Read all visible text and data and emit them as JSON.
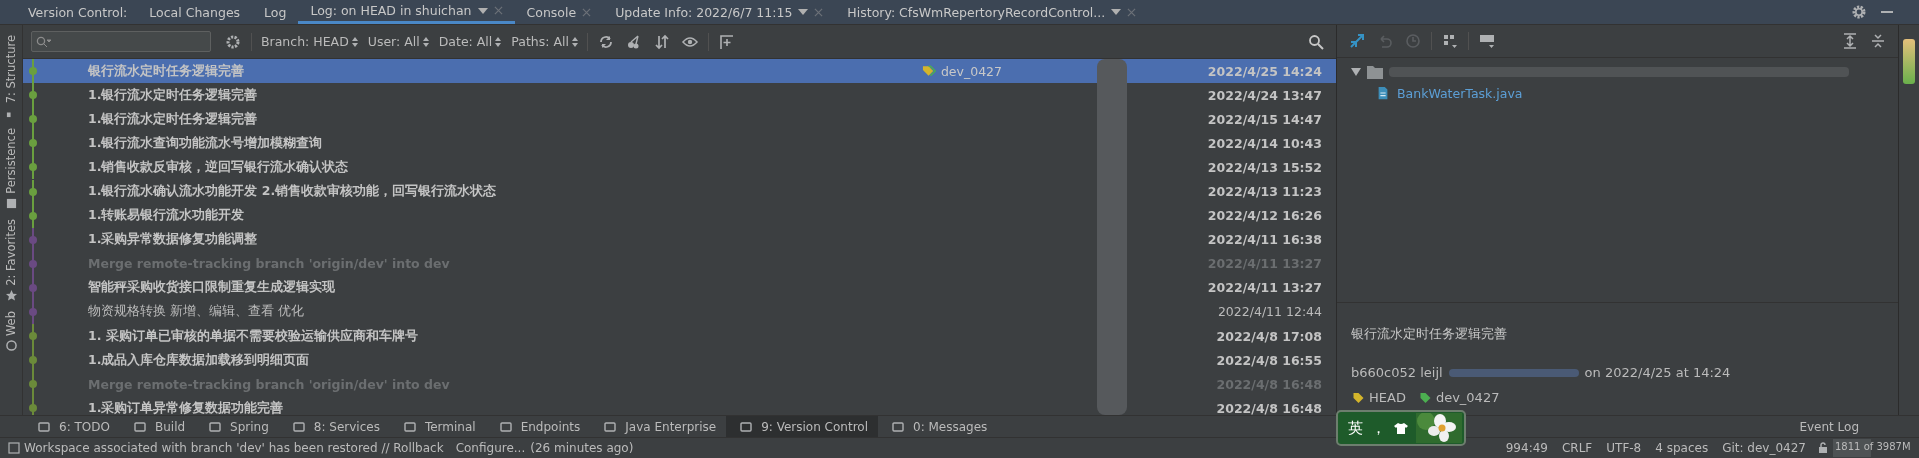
{
  "tool_window": {
    "label": "Version Control:",
    "tabs": [
      {
        "label": "Local Changes",
        "selected": false,
        "dropdown": false,
        "closable": false
      },
      {
        "label": "Log",
        "selected": false,
        "dropdown": false,
        "closable": false
      },
      {
        "label": "Log: on HEAD in shuichan",
        "selected": true,
        "dropdown": true,
        "closable": true
      },
      {
        "label": "Console",
        "selected": false,
        "dropdown": false,
        "closable": true
      },
      {
        "label": "Update Info: 2022/6/7 11:15",
        "selected": false,
        "dropdown": true,
        "closable": true
      },
      {
        "label": "History: CfsWmRepertoryRecordControl...",
        "selected": false,
        "dropdown": true,
        "closable": true
      }
    ]
  },
  "side_tools": [
    {
      "label": "7: Structure"
    },
    {
      "label": "Persistence"
    },
    {
      "label": "2: Favorites"
    },
    {
      "label": "Web"
    }
  ],
  "filters": [
    "Branch: HEAD",
    "User: All",
    "Date: All",
    "Paths: All"
  ],
  "commits": [
    {
      "message": "银行流水定时任务逻辑完善",
      "date": "2022/4/25 14:24",
      "kind": "own",
      "selected": true,
      "color": "#6a9f3f",
      "tag": "dev_0427"
    },
    {
      "message": "1.银行流水定时任务逻辑完善",
      "date": "2022/4/24 13:47",
      "kind": "own",
      "selected": false,
      "color": "#6a9f3f"
    },
    {
      "message": "1.银行流水定时任务逻辑完善",
      "date": "2022/4/15 14:47",
      "kind": "own",
      "selected": false,
      "color": "#6a9f3f"
    },
    {
      "message": "1.银行流水查询功能流水号增加模糊查询",
      "date": "2022/4/14 10:43",
      "kind": "own",
      "selected": false,
      "color": "#6a9f3f"
    },
    {
      "message": "1.销售收款反审核，逆回写银行流水确认状态",
      "date": "2022/4/13 15:52",
      "kind": "own",
      "selected": false,
      "color": "#6a9f3f"
    },
    {
      "message": "1.银行流水确认流水功能开发 2.销售收款审核功能，回写银行流水状态",
      "date": "2022/4/13 11:23",
      "kind": "own",
      "selected": false,
      "color": "#6a9f3f"
    },
    {
      "message": "1.转账易银行流水功能开发",
      "date": "2022/4/12 16:26",
      "kind": "own",
      "selected": false,
      "color": "#6a9f3f"
    },
    {
      "message": "1.采购异常数据修复功能调整",
      "date": "2022/4/11 16:38",
      "kind": "own",
      "selected": false,
      "color": "#6a4a82"
    },
    {
      "message": "Merge remote-tracking branch 'origin/dev' into dev",
      "date": "2022/4/11 13:27",
      "kind": "merge",
      "selected": false,
      "color": "#6a4a82"
    },
    {
      "message": "智能秤采购收货接口限制重复生成逻辑实现",
      "date": "2022/4/11 13:27",
      "kind": "own",
      "selected": false,
      "color": "#6a4a82"
    },
    {
      "message": "物资规格转换 新增、编辑、查看 优化",
      "date": "2022/4/11 12:44",
      "kind": "other",
      "selected": false,
      "color": "#6a4a82"
    },
    {
      "message": "1. 采购订单已审核的单据不需要校验运输供应商和车牌号",
      "date": "2022/4/8 17:08",
      "kind": "own",
      "selected": false,
      "color": "#6b8a3a"
    },
    {
      "message": "1.成品入库仓库数据加载移到明细页面",
      "date": "2022/4/8 16:55",
      "kind": "own",
      "selected": false,
      "color": "#6b8a3a"
    },
    {
      "message": "Merge remote-tracking branch 'origin/dev' into dev",
      "date": "2022/4/8 16:48",
      "kind": "merge",
      "selected": false,
      "color": "#6b8a3a"
    },
    {
      "message": "1.采购订单异常修复数据功能完善",
      "date": "2022/4/8 16:48",
      "kind": "own",
      "selected": false,
      "color": "#6b8a3a"
    }
  ],
  "changed_files": {
    "file": "BankWaterTask.java"
  },
  "details": {
    "message": "银行流水定时任务逻辑完善",
    "hash_author": "b660c052 leijl",
    "when": "on 2022/4/25 at 14:24",
    "tags": [
      {
        "label": "HEAD",
        "color": "#d4b52b"
      },
      {
        "label": "dev_0427",
        "color": "#4caf50"
      }
    ]
  },
  "bottom_tools": [
    {
      "label": "6: TODO",
      "selected": false
    },
    {
      "label": "Build",
      "selected": false
    },
    {
      "label": "Spring",
      "selected": false
    },
    {
      "label": "8: Services",
      "selected": false
    },
    {
      "label": "Terminal",
      "selected": false
    },
    {
      "label": "Endpoints",
      "selected": false
    },
    {
      "label": "Java Enterprise",
      "selected": false
    },
    {
      "label": "9: Version Control",
      "selected": true
    },
    {
      "label": "0: Messages",
      "selected": false
    }
  ],
  "input_method": {
    "mode": "英",
    "punct": "，"
  },
  "event_log": "Event Log",
  "status_bar": {
    "message": "Workspace associated with branch 'dev' has been restored // Rollback",
    "link": "Configure...",
    "age": "(26 minutes ago)",
    "position": "994:49",
    "line_sep": "CRLF",
    "encoding": "UTF-8",
    "indent": "4 spaces",
    "git": "Git: dev_0427",
    "memory": {
      "text": "1811 of 3987M",
      "level": 0.45
    }
  }
}
